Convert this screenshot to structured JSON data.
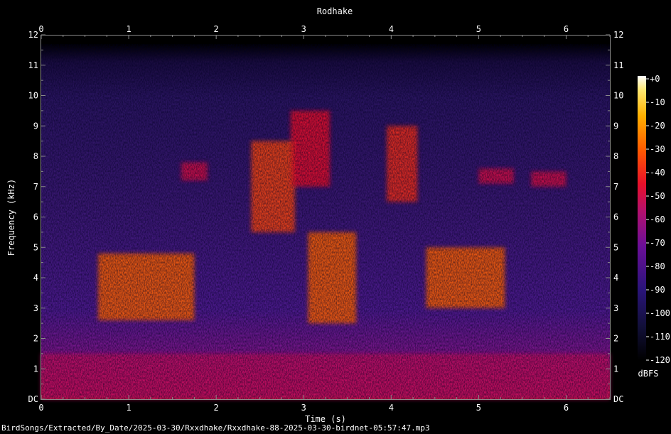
{
  "chart_data": {
    "type": "heatmap",
    "title": "Rodhake",
    "xlabel": "Time (s)",
    "ylabel": "Frequency (kHz)",
    "xlim": [
      0,
      6.5
    ],
    "ylim": [
      0,
      12
    ],
    "x_ticks": [
      "0",
      "1",
      "2",
      "3",
      "4",
      "5",
      "6"
    ],
    "y_ticks": [
      "DC",
      "1",
      "2",
      "3",
      "4",
      "5",
      "6",
      "7",
      "8",
      "9",
      "10",
      "11",
      "12"
    ],
    "colorbar": {
      "label": "dBFS",
      "range": [
        -120,
        0
      ],
      "ticks": [
        "+0",
        "-10",
        "-20",
        "-30",
        "-40",
        "-50",
        "-60",
        "-70",
        "-80",
        "-90",
        "-100",
        "-110",
        "-120"
      ]
    },
    "colors": {
      "background": "#000000",
      "low": "#000000",
      "mid_low": "#2a0f6e",
      "mid": "#7a0a98",
      "mid_high": "#e0103a",
      "high": "#ff8c00",
      "peak": "#ffffff"
    },
    "energy_regions": [
      {
        "t0": 0.0,
        "t1": 6.5,
        "f0": 0.0,
        "f1": 1.5,
        "level_dbfs": -55
      },
      {
        "t0": 0.65,
        "t1": 1.75,
        "f0": 2.6,
        "f1": 4.8,
        "level_dbfs": -30
      },
      {
        "t0": 1.6,
        "t1": 1.9,
        "f0": 7.2,
        "f1": 7.8,
        "level_dbfs": -50
      },
      {
        "t0": 2.4,
        "t1": 2.9,
        "f0": 5.5,
        "f1": 8.5,
        "level_dbfs": -35
      },
      {
        "t0": 3.05,
        "t1": 3.6,
        "f0": 2.5,
        "f1": 5.5,
        "level_dbfs": -30
      },
      {
        "t0": 2.85,
        "t1": 3.3,
        "f0": 7.0,
        "f1": 9.5,
        "level_dbfs": -45
      },
      {
        "t0": 3.95,
        "t1": 4.3,
        "f0": 6.5,
        "f1": 9.0,
        "level_dbfs": -40
      },
      {
        "t0": 4.4,
        "t1": 5.3,
        "f0": 3.0,
        "f1": 5.0,
        "level_dbfs": -30
      },
      {
        "t0": 5.0,
        "t1": 5.4,
        "f0": 7.1,
        "f1": 7.6,
        "level_dbfs": -50
      },
      {
        "t0": 5.6,
        "t1": 6.0,
        "f0": 7.0,
        "f1": 7.5,
        "level_dbfs": -50
      }
    ]
  },
  "footer": {
    "filepath": "BirdSongs/Extracted/By_Date/2025-03-30/Rxxdhake/Rxxdhake-88-2025-03-30-birdnet-05:57:47.mp3"
  }
}
